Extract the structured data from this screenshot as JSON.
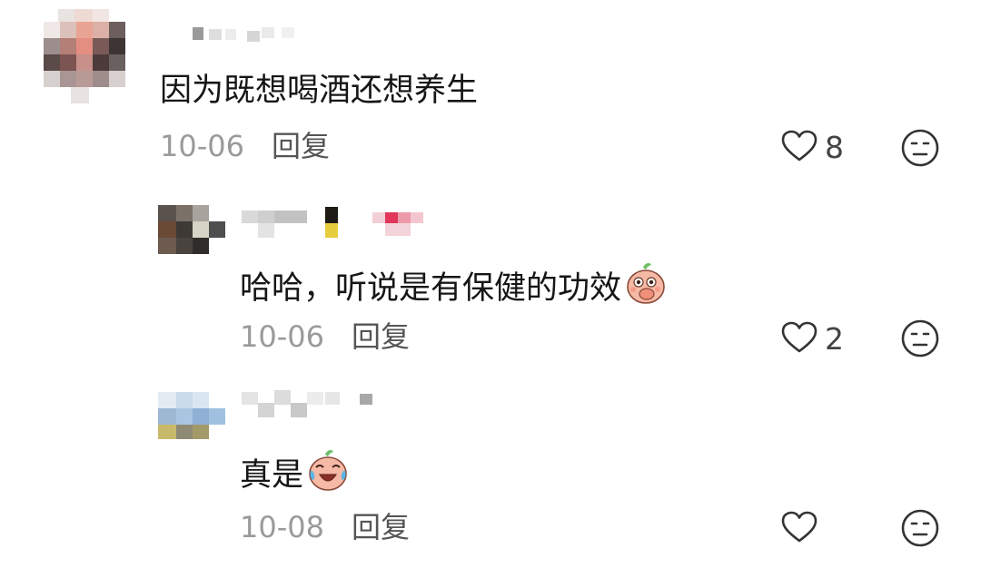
{
  "comments": [
    {
      "text": "因为既想喝酒还想养生",
      "date": "10-06",
      "reply_label": "回复",
      "likes": "8"
    },
    {
      "text": "哈哈，听说是有保健的功效",
      "emoji": "peach-cover-mouth-emoji",
      "date": "10-06",
      "reply_label": "回复",
      "likes": "2"
    },
    {
      "text": "真是",
      "emoji": "peach-laugh-cry-emoji",
      "date": "10-08",
      "reply_label": "回复",
      "likes": ""
    }
  ],
  "icons": {
    "like": "heart-outline-icon",
    "dislike": "neutral-face-icon"
  }
}
